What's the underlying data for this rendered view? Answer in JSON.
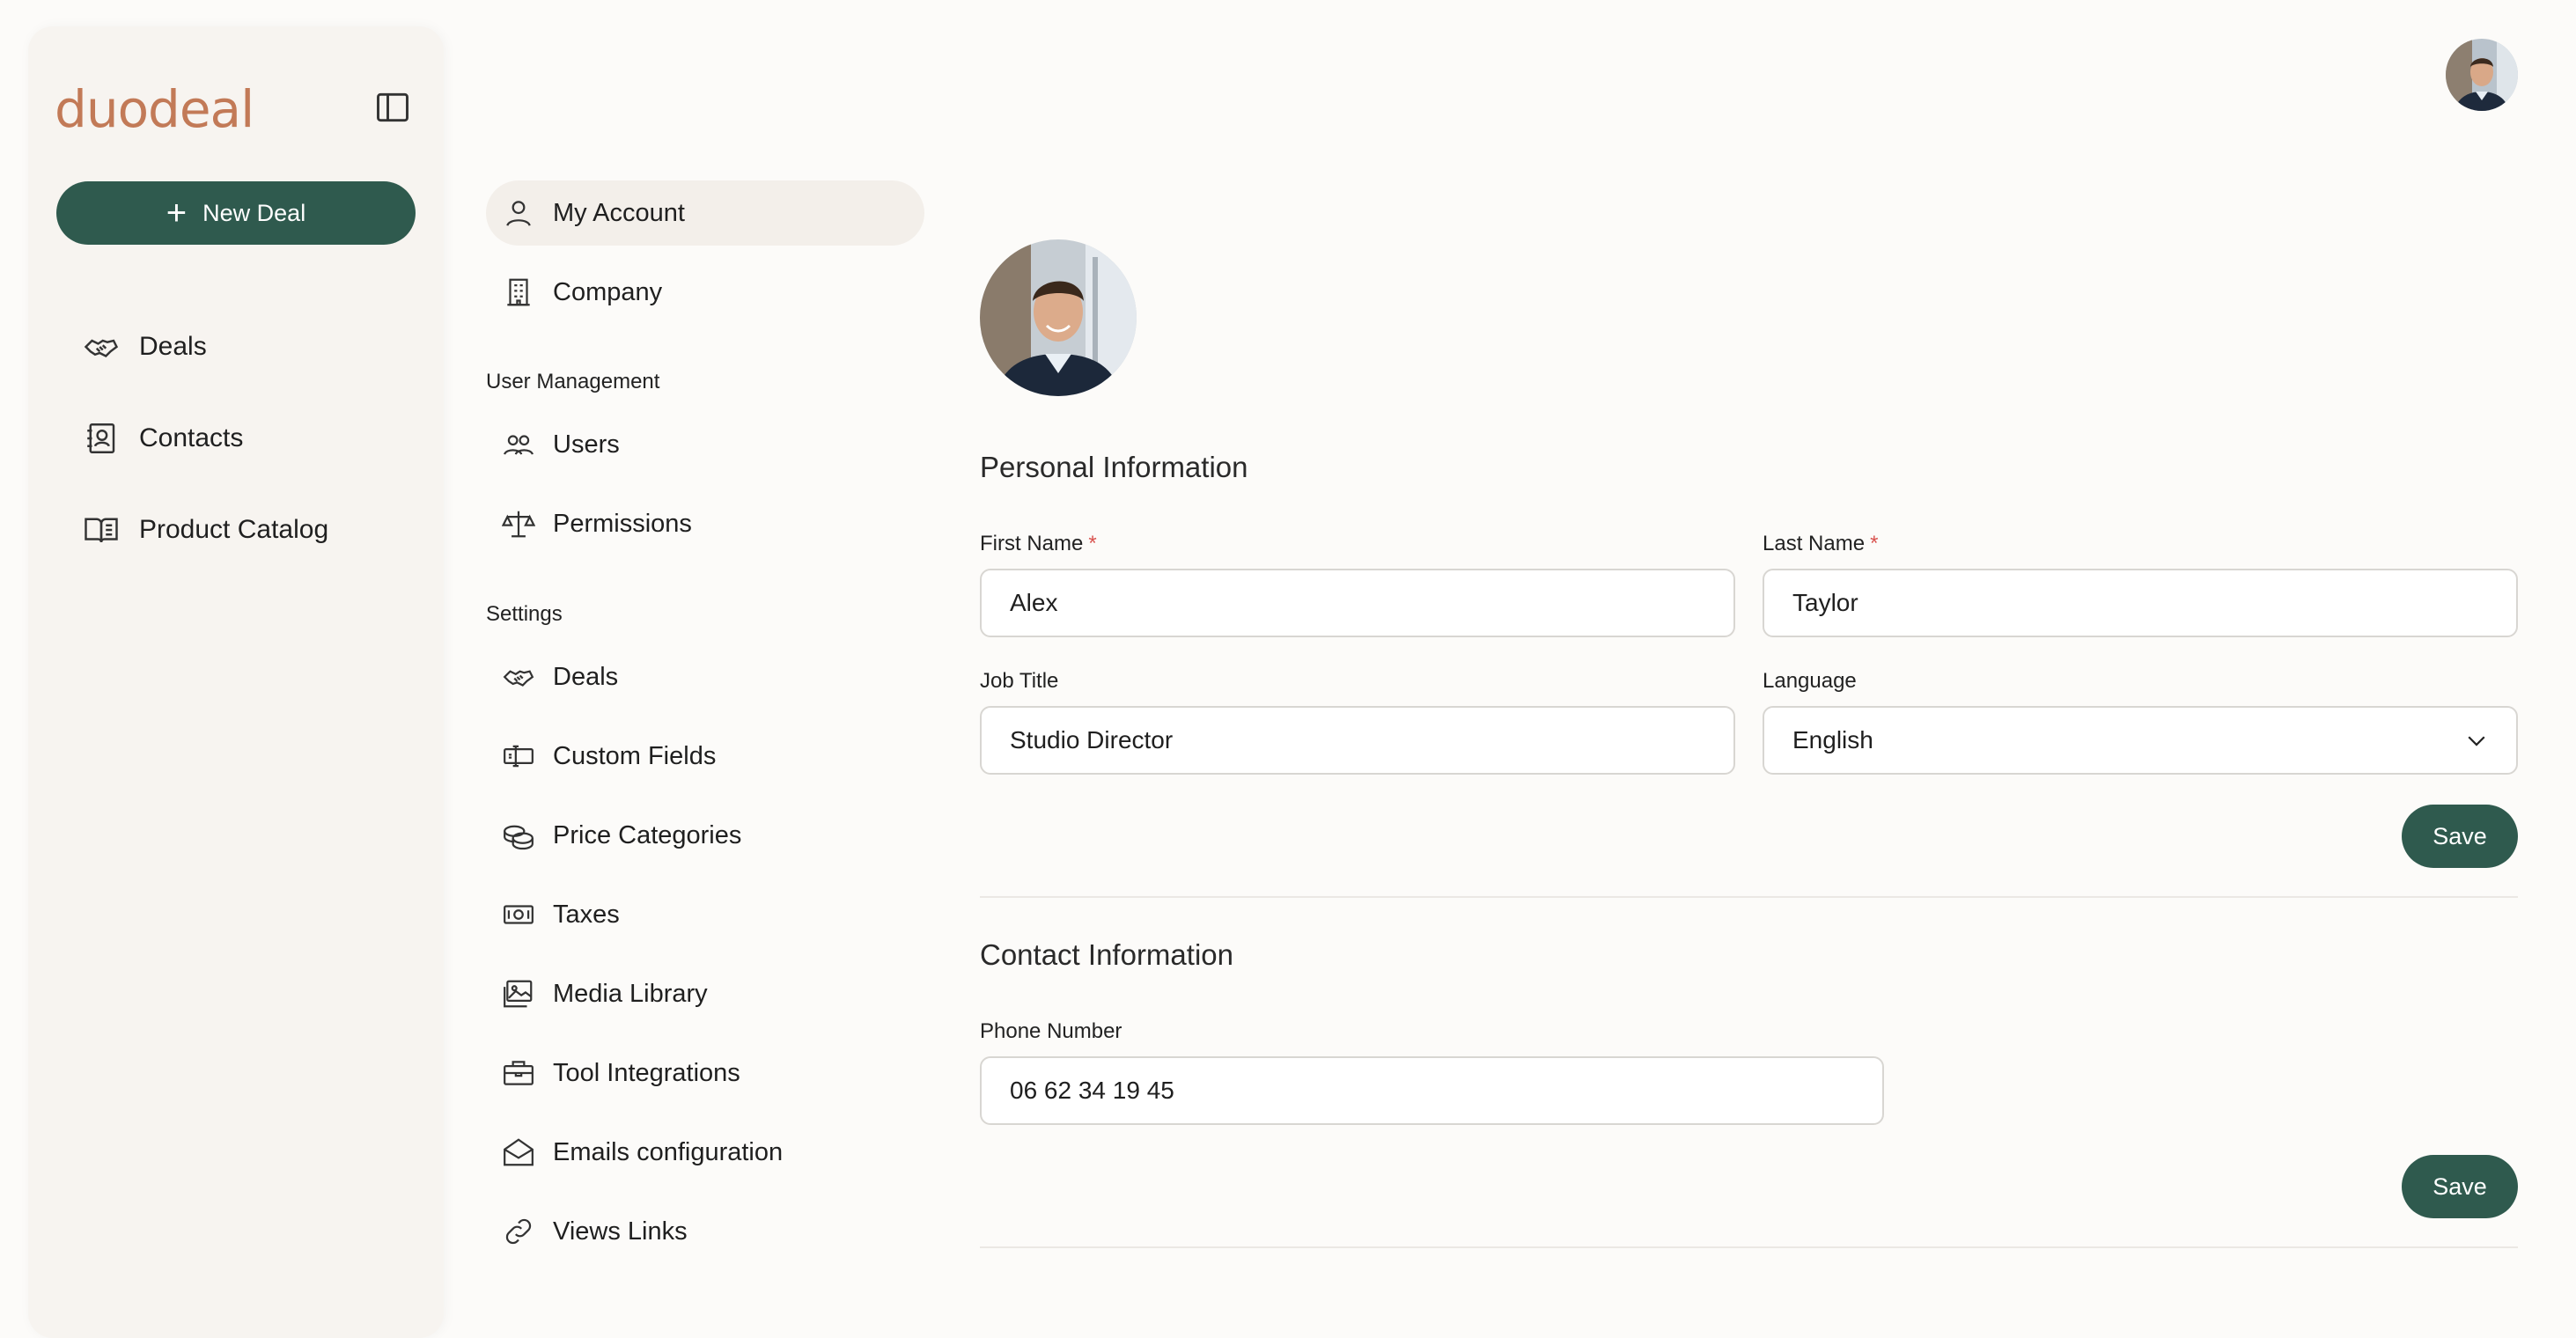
{
  "sidebar": {
    "logo": "duodeal",
    "new_deal_label": "New Deal",
    "items": [
      {
        "label": "Deals",
        "icon": "handshake-icon"
      },
      {
        "label": "Contacts",
        "icon": "contact-book-icon"
      },
      {
        "label": "Product Catalog",
        "icon": "book-open-icon"
      }
    ]
  },
  "settings_nav": {
    "top_items": [
      {
        "label": "My Account",
        "icon": "user-icon"
      },
      {
        "label": "Company",
        "icon": "building-icon"
      }
    ],
    "user_mgmt_label": "User Management",
    "user_mgmt_items": [
      {
        "label": "Users",
        "icon": "users-icon"
      },
      {
        "label": "Permissions",
        "icon": "scales-icon"
      }
    ],
    "settings_label": "Settings",
    "settings_items": [
      {
        "label": "Deals",
        "icon": "handshake-icon"
      },
      {
        "label": "Custom Fields",
        "icon": "custom-fields-icon"
      },
      {
        "label": "Price Categories",
        "icon": "coins-icon"
      },
      {
        "label": "Taxes",
        "icon": "banknote-icon"
      },
      {
        "label": "Media Library",
        "icon": "images-icon"
      },
      {
        "label": "Tool Integrations",
        "icon": "toolbox-icon"
      },
      {
        "label": "Emails configuration",
        "icon": "mail-open-icon"
      },
      {
        "label": "Views Links",
        "icon": "link-icon"
      }
    ]
  },
  "personal": {
    "title": "Personal Information",
    "first_name_label": "First Name",
    "first_name": "Alex",
    "last_name_label": "Last Name",
    "last_name": "Taylor",
    "required_mark": "*",
    "job_title_label": "Job Title",
    "job_title": "Studio Director",
    "language_label": "Language",
    "language": "English",
    "save_label": "Save"
  },
  "contact": {
    "title": "Contact Information",
    "phone_label": "Phone Number",
    "phone": "06 62 34 19 45",
    "save_label": "Save"
  },
  "colors": {
    "accent": "#2f5a4e",
    "logo": "#c27a57",
    "required": "#d9534f"
  }
}
